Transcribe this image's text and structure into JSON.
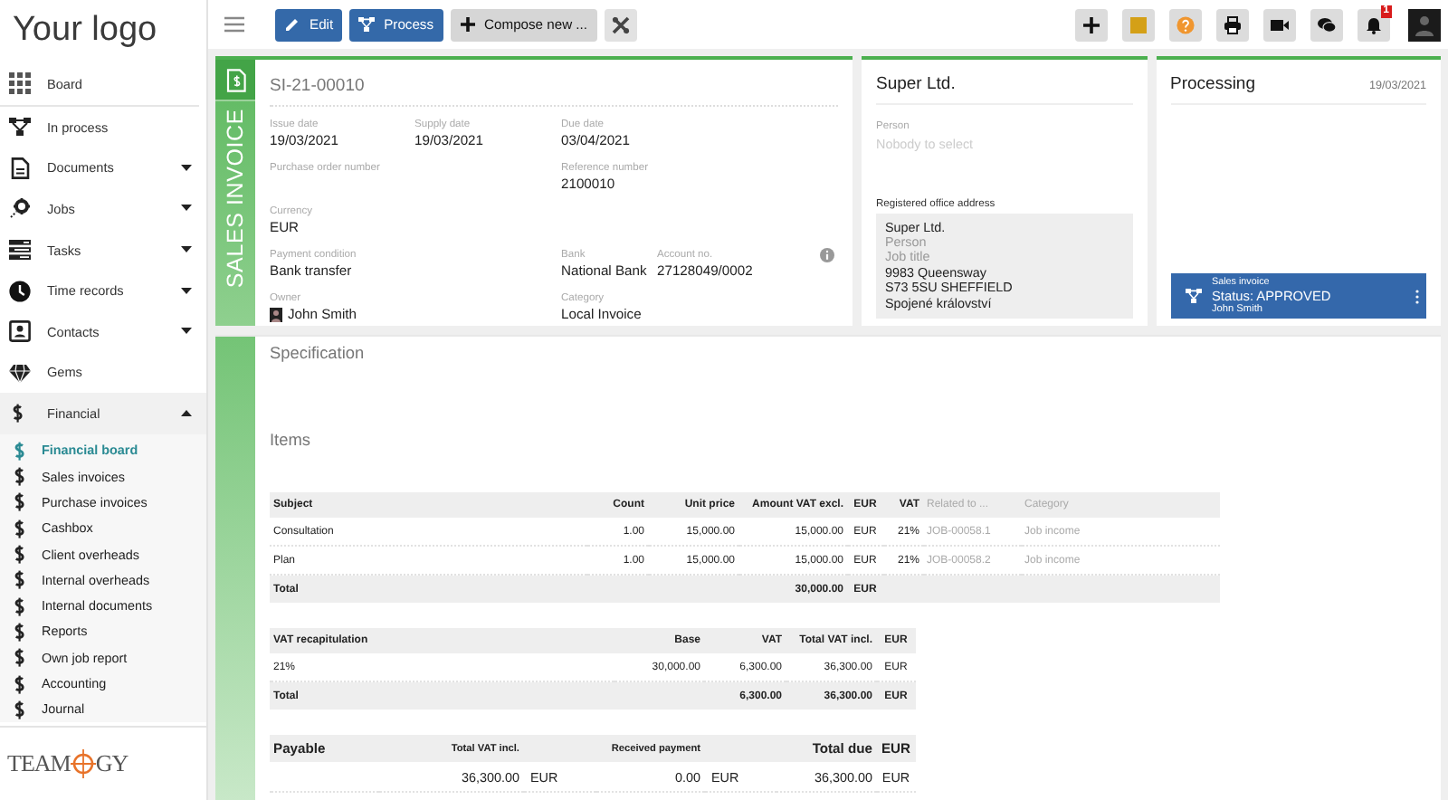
{
  "logo": "Your logo",
  "sidebar": {
    "items": [
      {
        "label": "Board",
        "kind": "link",
        "selected": false
      },
      {
        "label": "In process",
        "kind": "link",
        "selected": false
      },
      {
        "label": "Documents",
        "kind": "menu",
        "expanded": false,
        "selected": false
      },
      {
        "label": "Jobs",
        "kind": "menu",
        "expanded": false,
        "selected": false
      },
      {
        "label": "Tasks",
        "kind": "menu",
        "expanded": false,
        "selected": false
      },
      {
        "label": "Time records",
        "kind": "menu",
        "expanded": false,
        "selected": false
      },
      {
        "label": "Contacts",
        "kind": "menu",
        "expanded": false,
        "selected": false
      },
      {
        "label": "Gems",
        "kind": "link",
        "selected": false
      },
      {
        "label": "Financial",
        "kind": "menu",
        "expanded": true,
        "selected": true,
        "children": [
          {
            "label": "Financial board",
            "selected": true
          },
          {
            "label": "Sales invoices",
            "selected": false
          },
          {
            "label": "Purchase invoices",
            "selected": false
          },
          {
            "label": "Cashbox",
            "selected": false
          },
          {
            "label": "Client overheads",
            "selected": false
          },
          {
            "label": "Internal overheads",
            "selected": false
          },
          {
            "label": "Internal documents",
            "selected": false
          },
          {
            "label": "Reports",
            "selected": false
          },
          {
            "label": "Own job report",
            "selected": false
          },
          {
            "label": "Accounting",
            "selected": false
          },
          {
            "label": "Journal",
            "selected": false
          }
        ]
      }
    ]
  },
  "footer_logo": {
    "left": "TEAM",
    "right": "GY"
  },
  "toolbar": {
    "buttons": [
      {
        "kind": "primary",
        "label": "Edit"
      },
      {
        "kind": "primary",
        "label": "Process"
      },
      {
        "kind": "secondary",
        "label": "Compose new ..."
      },
      {
        "kind": "tool"
      }
    ],
    "notification_count": "1"
  },
  "invoice": {
    "side_label": "SALES INVOICE",
    "number": "SI-21-00010",
    "fields": [
      {
        "kind": "text",
        "label": "Issue date",
        "value": "19/03/2021"
      },
      {
        "kind": "text",
        "label": "Supply date",
        "value": "19/03/2021"
      },
      {
        "kind": "text",
        "label": "Due date",
        "value": "03/04/2021"
      },
      {
        "kind": "text",
        "label": "Purchase order number"
      },
      {
        "kind": "text",
        "label": "Reference number",
        "value": "2100010"
      },
      {
        "kind": "text",
        "label": "Currency",
        "value": "EUR"
      },
      {
        "kind": "text",
        "label": "Payment condition",
        "value": "Bank transfer"
      },
      {
        "kind": "text",
        "label": "Bank",
        "value": "National Bank"
      },
      {
        "kind": "text",
        "label": "Account no.",
        "value": "27128049/0002"
      },
      {
        "kind": "person",
        "label": "Owner",
        "value": "John Smith"
      },
      {
        "kind": "text",
        "label": "Category",
        "value": "Local Invoice"
      }
    ]
  },
  "customer": {
    "title": "Super Ltd.",
    "person_label": "Person",
    "person_placeholder": "Nobody to select",
    "address_label": "Registered office address",
    "address_lines": [
      {
        "kind": "value",
        "text": "Super Ltd."
      },
      {
        "kind": "placeholder",
        "text": "Person"
      },
      {
        "kind": "placeholder",
        "text": "Job title"
      },
      {
        "kind": "value",
        "text": "9983 Queensway"
      },
      {
        "kind": "value",
        "text": "S73 5SU SHEFFIELD"
      },
      {
        "kind": "value",
        "text": "Spojené království"
      }
    ]
  },
  "processing": {
    "title": "Processing",
    "date": "19/03/2021",
    "status_card": {
      "type": "Sales invoice",
      "status": "Status: APPROVED",
      "person": "John Smith"
    }
  },
  "specification": {
    "title": "Specification",
    "items_title": "Items",
    "items_table": {
      "columns": [
        "Subject",
        "Count",
        "Unit price",
        "Amount VAT excl.",
        "EUR",
        "VAT",
        "Related to ...",
        "Category"
      ],
      "rows": [
        [
          "Consultation",
          "1.00",
          "15,000.00",
          "15,000.00",
          "EUR",
          "21%",
          "JOB-00058.1",
          "Job income"
        ],
        [
          "Plan",
          "1.00",
          "15,000.00",
          "15,000.00",
          "EUR",
          "21%",
          "JOB-00058.2",
          "Job income"
        ]
      ],
      "total": {
        "label": "Total",
        "amount": "30,000.00",
        "currency": "EUR"
      }
    },
    "vat_table": {
      "columns": [
        "VAT recapitulation",
        "Base",
        "VAT",
        "Total VAT incl.",
        "EUR"
      ],
      "rows": [
        [
          "21%",
          "30,000.00",
          "6,300.00",
          "36,300.00",
          "EUR"
        ]
      ],
      "total": {
        "label": "Total",
        "vat": "6,300.00",
        "total": "36,300.00",
        "currency": "EUR"
      }
    },
    "payable_table": {
      "columns": [
        "Payable",
        "Total VAT incl.",
        "Received payment",
        "Total due",
        "EUR"
      ],
      "row": {
        "total_vat_incl": "36,300.00",
        "total_vat_currency": "EUR",
        "received": "0.00",
        "received_currency": "EUR",
        "total_due": "36,300.00",
        "currency": "EUR"
      }
    }
  }
}
